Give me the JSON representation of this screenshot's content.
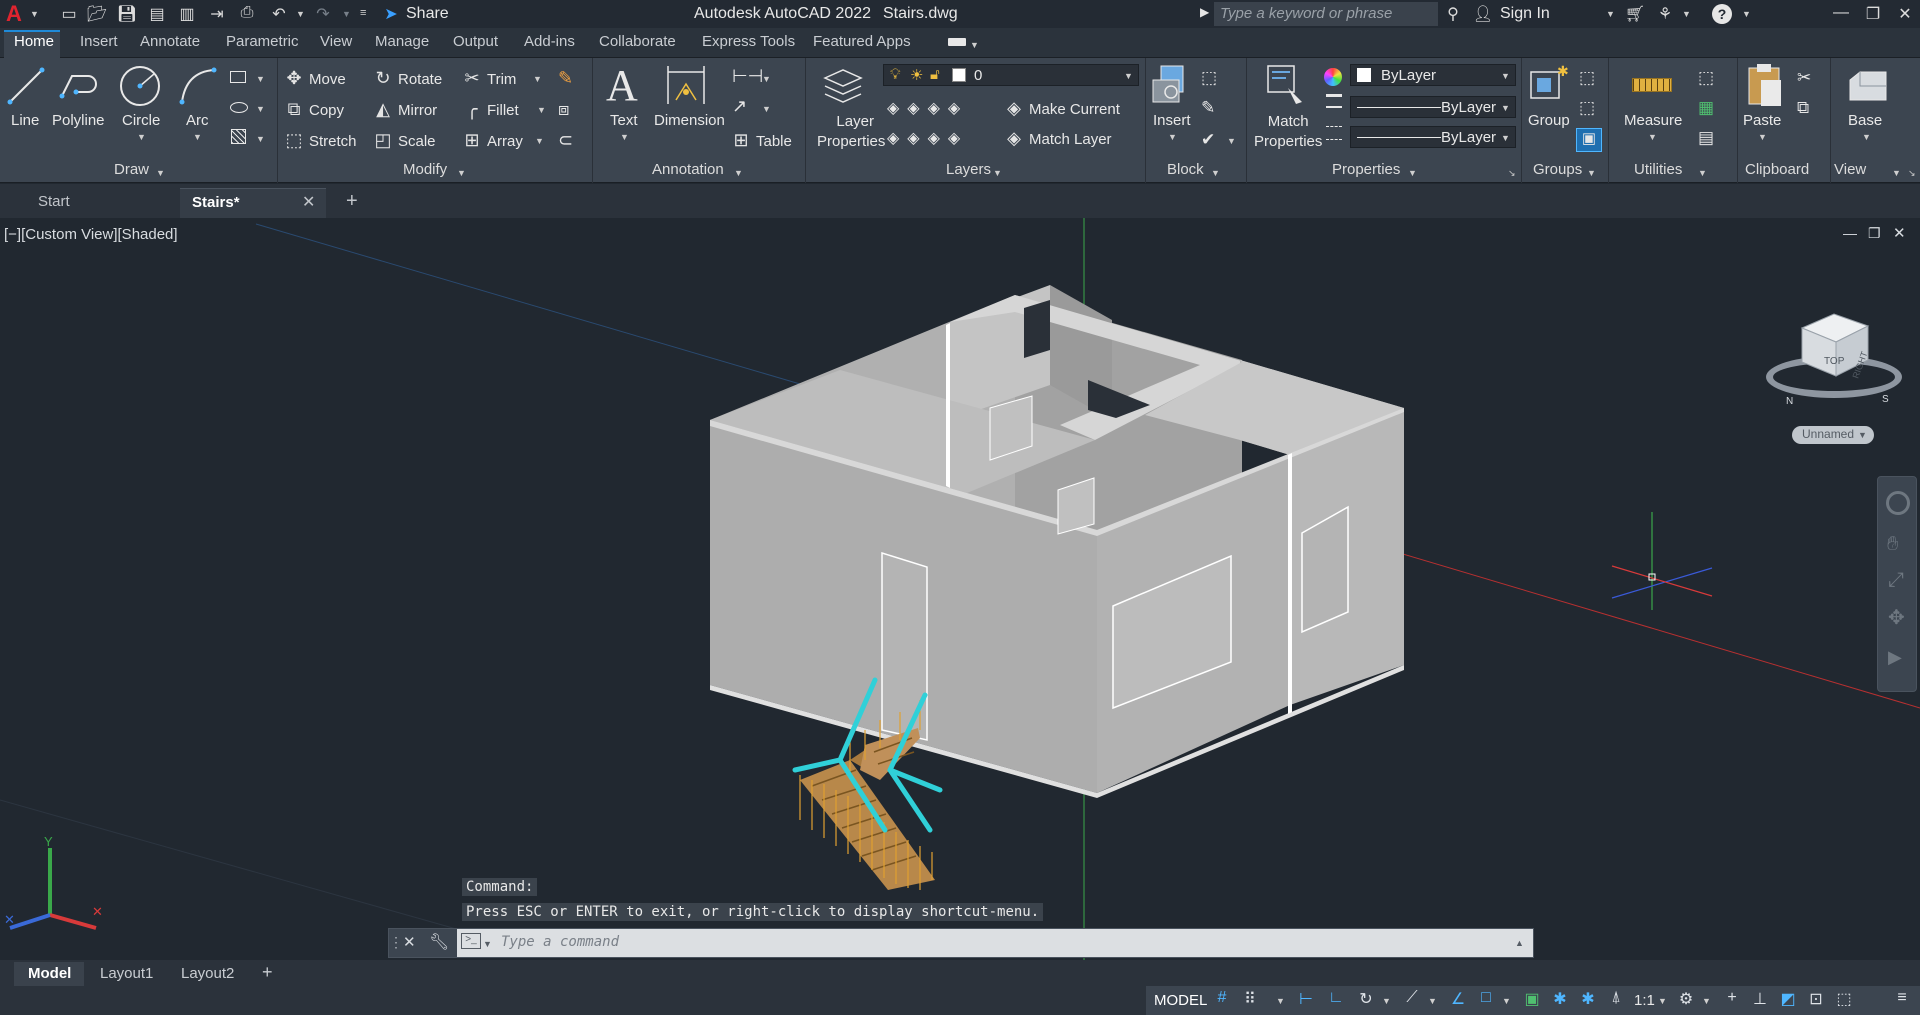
{
  "app": {
    "title": "Autodesk AutoCAD 2022",
    "filename": "Stairs.dwg",
    "logo": "A",
    "share": "Share",
    "search_placeholder": "Type a keyword or phrase",
    "sign_in": "Sign In",
    "accent": "#1f8ad8"
  },
  "ribbon_tabs": [
    "Home",
    "Insert",
    "Annotate",
    "Parametric",
    "View",
    "Manage",
    "Output",
    "Add-ins",
    "Collaborate",
    "Express Tools",
    "Featured Apps"
  ],
  "draw": {
    "label": "Draw",
    "line": "Line",
    "polyline": "Polyline",
    "circle": "Circle",
    "arc": "Arc"
  },
  "modify": {
    "label": "Modify",
    "move": "Move",
    "rotate": "Rotate",
    "trim": "Trim",
    "copy": "Copy",
    "mirror": "Mirror",
    "fillet": "Fillet",
    "stretch": "Stretch",
    "scale": "Scale",
    "array": "Array"
  },
  "annotation": {
    "label": "Annotation",
    "text": "Text",
    "dimension": "Dimension",
    "table": "Table"
  },
  "layers": {
    "label": "Layers",
    "layer_properties_1": "Layer",
    "layer_properties_2": "Properties",
    "current_layer": "0",
    "make_current": "Make Current",
    "match_layer": "Match Layer"
  },
  "block": {
    "label": "Block",
    "insert": "Insert"
  },
  "properties": {
    "label": "Properties",
    "match_1": "Match",
    "match_2": "Properties",
    "color": "ByLayer",
    "linetype": "ByLayer",
    "lineweight": "ByLayer"
  },
  "groups": {
    "label": "Groups",
    "group": "Group"
  },
  "utilities": {
    "label": "Utilities",
    "measure": "Measure"
  },
  "clipboard": {
    "label": "Clipboard",
    "paste": "Paste"
  },
  "view": {
    "label": "View",
    "base": "Base"
  },
  "doc_tabs": {
    "start": "Start",
    "active": "Stairs*"
  },
  "viewport": {
    "label": "[−][Custom View][Shaded]",
    "viewcube_top": "TOP",
    "viewcube_right": "RIGHT",
    "compass_n": "N",
    "viewcube_s": "S",
    "ucs_named": "Unnamed",
    "axis_y": "Y"
  },
  "command": {
    "history_1": "Command:",
    "history_2": "Press ESC or ENTER to exit, or right-click to display shortcut-menu.",
    "placeholder": "Type a command"
  },
  "layout_tabs": [
    "Model",
    "Layout1",
    "Layout2"
  ],
  "status": {
    "model": "MODEL",
    "scale": "1:1"
  }
}
